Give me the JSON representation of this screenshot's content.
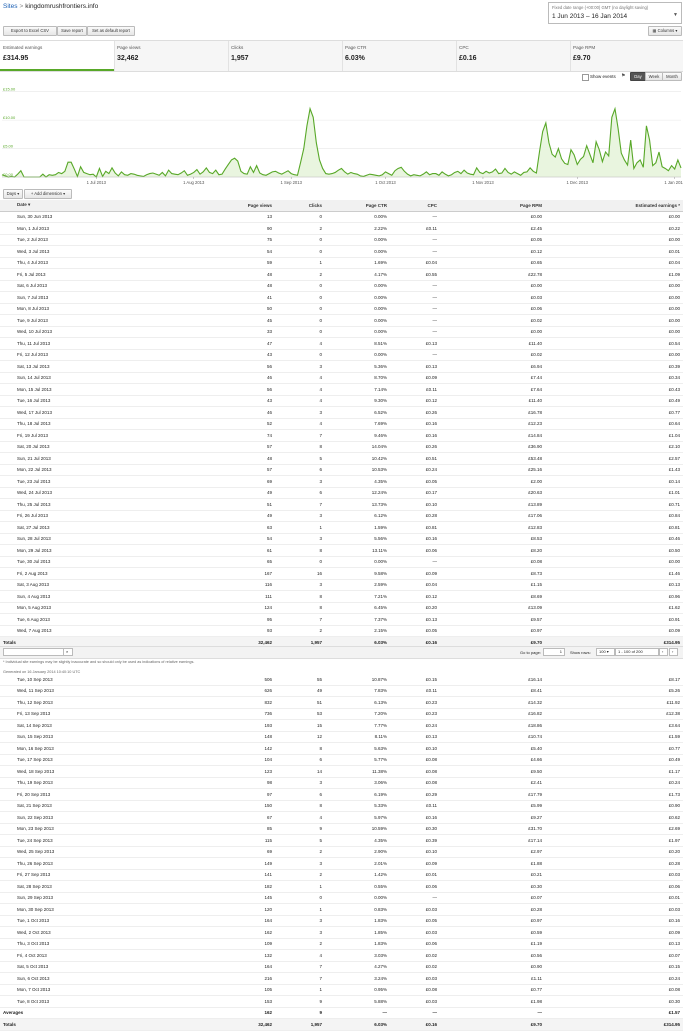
{
  "header": {
    "crumb_root": "Sites",
    "crumb_sep": ">",
    "site_name": "kingdomrushfrontiers.info",
    "date_note": "Fixed date range (+00:00) GMT (no daylight saving)",
    "date_range": "1 Jun 2013 – 16 Jan 2014"
  },
  "toolbar": {
    "export_label": "Export to Excel CSV",
    "save_label": "Save report",
    "default_label": "Set as default report",
    "columns_label": "Columns"
  },
  "scorecards": [
    {
      "label": "Estimated earnings",
      "value": "£314.95"
    },
    {
      "label": "Page views",
      "value": "32,462"
    },
    {
      "label": "Clicks",
      "value": "1,957"
    },
    {
      "label": "Page CTR",
      "value": "6.03%"
    },
    {
      "label": "CPC",
      "value": "£0.16"
    },
    {
      "label": "Page RPM",
      "value": "£9.70"
    }
  ],
  "chart_opts": {
    "show_events": "Show events",
    "day": "Day",
    "week": "Week",
    "month": "Month"
  },
  "chart_data": {
    "type": "area",
    "series": [
      {
        "values": [
          0.4,
          0.2,
          0.0,
          0.1,
          0.0,
          0.5,
          1.1,
          0.0,
          0.0,
          0.0,
          0.0,
          0.0,
          0.0,
          0.5,
          0.0,
          0.4,
          0.3,
          0.4,
          0.8,
          0.6,
          1.0,
          2.6,
          2.6,
          1.4,
          0.1,
          1.8,
          0.8,
          0.6,
          0.4,
          0.5,
          0.0,
          1.5,
          0.1,
          1.0,
          0.6,
          1.6,
          0.7,
          0.2,
          0.9,
          0.4,
          0.3,
          0.6,
          0.5,
          0.3,
          0.2,
          0.1,
          0.4,
          0.6,
          0.7,
          0.5,
          0.3,
          0.8,
          0.2,
          1.2,
          0.6,
          0.5,
          0.4,
          0.7,
          1.1,
          0.3,
          0.5,
          0.8,
          1.3,
          0.5,
          0.9,
          1.6,
          0.8,
          0.6,
          1.2,
          0.4,
          0.5,
          1.4,
          2.2,
          3.0,
          3.3,
          2.8,
          1.0,
          0.6,
          0.5,
          1.8,
          0.8,
          2.0,
          0.7,
          0.4,
          0.3,
          0.6,
          0.9,
          1.0,
          0.7,
          0.5,
          0.8,
          1.1,
          0.6,
          0.4,
          0.3,
          2.6,
          5.0,
          9.0,
          12.0,
          10.5,
          6.0,
          3.0,
          1.5,
          0.6,
          0.5,
          0.6,
          0.8,
          1.2,
          1.5,
          0.9,
          0.5,
          0.8,
          0.6,
          0.5,
          0.2,
          0.1,
          0.3,
          0.5,
          0.4,
          0.3,
          0.2,
          0.4,
          0.9,
          0.6,
          0.3,
          1.1,
          1.5,
          1.7,
          1.0,
          0.5,
          0.2,
          0.4,
          0.3,
          0.2,
          0.5,
          0.9,
          0.4,
          0.6,
          0.6,
          0.3,
          0.9,
          0.5,
          0.2,
          0.4,
          0.8,
          1.0,
          0.6,
          1.2,
          0.7,
          0.5,
          0.4,
          1.6,
          0.8,
          0.6,
          1.0,
          0.7,
          0.9,
          1.4,
          0.6,
          0.7,
          1.5,
          0.8,
          0.5,
          0.9,
          0.6,
          0.3,
          0.8,
          0.9,
          1.6,
          1.0,
          0.7,
          4.5,
          8.0,
          9.5,
          6.0,
          4.0,
          3.5,
          5.0,
          3.2,
          2.4,
          2.2,
          4.8,
          3.9,
          2.2,
          3.1,
          3.6,
          5.5,
          4.0,
          2.5,
          6.2,
          4.8,
          2.7,
          4.4,
          3.7,
          10.5,
          12.0,
          8.5,
          4.2,
          3.0,
          2.1,
          6.5,
          1.5,
          2.5,
          3.0,
          1.7,
          9.0,
          6.5,
          2.0,
          2.5,
          4.4,
          1.8,
          1.5,
          1.1,
          2.0,
          1.4,
          3.0,
          1.6
        ]
      }
    ],
    "ylabels": [
      "£15.00",
      "£10.00",
      "£5.00",
      "£0.00"
    ],
    "yticks": [
      15,
      10,
      5,
      0
    ],
    "ylim": [
      0,
      16
    ],
    "xlabels": [
      "1 Jul 2013",
      "1 Aug 2013",
      "1 Sep 2013",
      "1 Oct 2013",
      "1 Nov 2013",
      "1 Dec 2013",
      "1 Jan 2014"
    ],
    "xtick_days": [
      30,
      61,
      92,
      122,
      153,
      183,
      214
    ],
    "color": "#58a828",
    "fill": "#e9f5df"
  },
  "table_bar": {
    "dimension": "Days",
    "add_dimension": "Add dimension"
  },
  "columns": [
    "Date",
    "Page views",
    "Clicks",
    "Page CTR",
    "CPC",
    "Page RPM",
    "Estimated earnings"
  ],
  "top_rows": [
    [
      "Sun, 30 Jun 2013",
      "13",
      "0",
      "0.00%",
      "—",
      "£0.00",
      "£0.00"
    ],
    [
      "Mon, 1 Jul 2013",
      "90",
      "2",
      "2.22%",
      "£0.11",
      "£2.45",
      "£0.22"
    ],
    [
      "Tue, 2 Jul 2013",
      "75",
      "0",
      "0.00%",
      "—",
      "£0.05",
      "£0.00"
    ],
    [
      "Wed, 3 Jul 2013",
      "54",
      "0",
      "0.00%",
      "—",
      "£0.12",
      "£0.01"
    ],
    [
      "Thu, 4 Jul 2013",
      "59",
      "1",
      "1.69%",
      "£0.04",
      "£0.65",
      "£0.04"
    ],
    [
      "Fri, 5 Jul 2013",
      "48",
      "2",
      "4.17%",
      "£0.55",
      "£22.78",
      "£1.09"
    ],
    [
      "Sat, 6 Jul 2013",
      "48",
      "0",
      "0.00%",
      "—",
      "£0.00",
      "£0.00"
    ],
    [
      "Sun, 7 Jul 2013",
      "41",
      "0",
      "0.00%",
      "—",
      "£0.03",
      "£0.00"
    ],
    [
      "Mon, 8 Jul 2013",
      "50",
      "0",
      "0.00%",
      "—",
      "£0.06",
      "£0.00"
    ],
    [
      "Tue, 9 Jul 2013",
      "45",
      "0",
      "0.00%",
      "—",
      "£0.02",
      "£0.00"
    ],
    [
      "Wed, 10 Jul 2013",
      "33",
      "0",
      "0.00%",
      "—",
      "£0.00",
      "£0.00"
    ],
    [
      "Thu, 11 Jul 2013",
      "47",
      "4",
      "8.51%",
      "£0.13",
      "£11.40",
      "£0.54"
    ],
    [
      "Fri, 12 Jul 2013",
      "43",
      "0",
      "0.00%",
      "—",
      "£0.02",
      "£0.00"
    ],
    [
      "Sat, 13 Jul 2013",
      "56",
      "3",
      "5.36%",
      "£0.13",
      "£6.94",
      "£0.39"
    ],
    [
      "Sun, 14 Jul 2013",
      "46",
      "4",
      "8.70%",
      "£0.09",
      "£7.44",
      "£0.34"
    ],
    [
      "Mon, 15 Jul 2013",
      "56",
      "4",
      "7.14%",
      "£0.11",
      "£7.64",
      "£0.43"
    ],
    [
      "Tue, 16 Jul 2013",
      "43",
      "4",
      "9.30%",
      "£0.12",
      "£11.40",
      "£0.49"
    ],
    [
      "Wed, 17 Jul 2013",
      "46",
      "3",
      "6.52%",
      "£0.26",
      "£16.78",
      "£0.77"
    ],
    [
      "Thu, 18 Jul 2013",
      "52",
      "4",
      "7.69%",
      "£0.16",
      "£12.23",
      "£0.64"
    ],
    [
      "Fri, 19 Jul 2013",
      "74",
      "7",
      "9.46%",
      "£0.16",
      "£14.84",
      "£1.04"
    ],
    [
      "Sat, 20 Jul 2013",
      "57",
      "8",
      "14.04%",
      "£0.26",
      "£36.90",
      "£2.10"
    ],
    [
      "Sun, 21 Jul 2013",
      "48",
      "5",
      "10.42%",
      "£0.51",
      "£53.48",
      "£2.57"
    ],
    [
      "Mon, 22 Jul 2013",
      "57",
      "6",
      "10.53%",
      "£0.24",
      "£25.16",
      "£1.43"
    ],
    [
      "Tue, 23 Jul 2013",
      "69",
      "3",
      "4.35%",
      "£0.05",
      "£2.00",
      "£0.14"
    ],
    [
      "Wed, 24 Jul 2013",
      "49",
      "6",
      "12.24%",
      "£0.17",
      "£20.63",
      "£1.01"
    ],
    [
      "Thu, 25 Jul 2013",
      "51",
      "7",
      "13.73%",
      "£0.10",
      "£13.89",
      "£0.71"
    ],
    [
      "Fri, 26 Jul 2013",
      "49",
      "3",
      "6.12%",
      "£0.28",
      "£17.06",
      "£0.84"
    ],
    [
      "Sat, 27 Jul 2013",
      "63",
      "1",
      "1.59%",
      "£0.81",
      "£12.83",
      "£0.81"
    ],
    [
      "Sun, 28 Jul 2013",
      "54",
      "3",
      "5.56%",
      "£0.16",
      "£8.53",
      "£0.46"
    ],
    [
      "Mon, 29 Jul 2013",
      "61",
      "8",
      "13.11%",
      "£0.06",
      "£8.20",
      "£0.50"
    ],
    [
      "Tue, 30 Jul 2013",
      "65",
      "0",
      "0.00%",
      "—",
      "£0.08",
      "£0.00"
    ],
    [
      "Fri, 2 Aug 2013",
      "167",
      "16",
      "9.58%",
      "£0.09",
      "£8.73",
      "£1.46"
    ],
    [
      "Sat, 3 Aug 2013",
      "116",
      "3",
      "2.59%",
      "£0.04",
      "£1.15",
      "£0.13"
    ],
    [
      "Sun, 4 Aug 2013",
      "111",
      "8",
      "7.21%",
      "£0.12",
      "£8.69",
      "£0.96"
    ],
    [
      "Mon, 5 Aug 2013",
      "124",
      "8",
      "6.45%",
      "£0.20",
      "£13.09",
      "£1.62"
    ],
    [
      "Tue, 6 Aug 2013",
      "95",
      "7",
      "7.37%",
      "£0.13",
      "£9.57",
      "£0.91"
    ],
    [
      "Wed, 7 Aug 2013",
      "93",
      "2",
      "2.15%",
      "£0.05",
      "£0.97",
      "£0.09"
    ]
  ],
  "totals": {
    "label": "Totals",
    "page_views": "32,462",
    "clicks": "1,957",
    "ctr": "6.03%",
    "cpc": "£0.16",
    "rpm": "£9.70",
    "earnings": "£314.95"
  },
  "pager": {
    "go_to_page": "Go to page:",
    "page_value": "1",
    "show_rows": "Show rows:",
    "rows_value": "100",
    "range": "1 - 100 of 200"
  },
  "footnote": "* Individual site earnings may be slightly inaccurate and so should only be used as indications of relative earnings.",
  "generated": "Generated on 16 January 2014 10:40:10 UTC",
  "bottom_rows": [
    [
      "Tue, 10 Sep 2013",
      "506",
      "55",
      "10.87%",
      "£0.15",
      "£16.14",
      "£8.17"
    ],
    [
      "Wed, 11 Sep 2013",
      "626",
      "49",
      "7.83%",
      "£0.11",
      "£8.41",
      "£5.26"
    ],
    [
      "Thu, 12 Sep 2013",
      "832",
      "51",
      "6.13%",
      "£0.23",
      "£14.32",
      "£11.92"
    ],
    [
      "Fri, 13 Sep 2013",
      "736",
      "53",
      "7.20%",
      "£0.23",
      "£16.82",
      "£12.38"
    ],
    [
      "Sat, 14 Sep 2013",
      "193",
      "15",
      "7.77%",
      "£0.24",
      "£18.86",
      "£3.64"
    ],
    [
      "Sun, 15 Sep 2013",
      "148",
      "12",
      "8.11%",
      "£0.13",
      "£10.74",
      "£1.59"
    ],
    [
      "Mon, 16 Sep 2013",
      "142",
      "8",
      "5.63%",
      "£0.10",
      "£5.40",
      "£0.77"
    ],
    [
      "Tue, 17 Sep 2013",
      "104",
      "6",
      "5.77%",
      "£0.08",
      "£4.66",
      "£0.49"
    ],
    [
      "Wed, 18 Sep 2013",
      "123",
      "14",
      "11.38%",
      "£0.08",
      "£9.50",
      "£1.17"
    ],
    [
      "Thu, 19 Sep 2013",
      "98",
      "3",
      "3.06%",
      "£0.08",
      "£2.41",
      "£0.24"
    ],
    [
      "Fri, 20 Sep 2013",
      "97",
      "6",
      "6.19%",
      "£0.29",
      "£17.79",
      "£1.73"
    ],
    [
      "Sat, 21 Sep 2013",
      "150",
      "8",
      "5.33%",
      "£0.11",
      "£5.99",
      "£0.90"
    ],
    [
      "Sun, 22 Sep 2013",
      "67",
      "4",
      "5.97%",
      "£0.16",
      "£9.27",
      "£0.62"
    ],
    [
      "Mon, 23 Sep 2013",
      "85",
      "9",
      "10.59%",
      "£0.30",
      "£31.70",
      "£2.69"
    ],
    [
      "Tue, 24 Sep 2013",
      "115",
      "5",
      "4.35%",
      "£0.39",
      "£17.14",
      "£1.97"
    ],
    [
      "Wed, 25 Sep 2013",
      "69",
      "2",
      "2.90%",
      "£0.10",
      "£2.97",
      "£0.20"
    ],
    [
      "Thu, 26 Sep 2013",
      "149",
      "3",
      "2.01%",
      "£0.09",
      "£1.88",
      "£0.28"
    ],
    [
      "Fri, 27 Sep 2013",
      "141",
      "2",
      "1.42%",
      "£0.01",
      "£0.21",
      "£0.03"
    ],
    [
      "Sat, 28 Sep 2013",
      "182",
      "1",
      "0.55%",
      "£0.06",
      "£0.30",
      "£0.06"
    ],
    [
      "Sun, 29 Sep 2013",
      "145",
      "0",
      "0.00%",
      "—",
      "£0.07",
      "£0.01"
    ],
    [
      "Mon, 30 Sep 2013",
      "120",
      "1",
      "0.83%",
      "£0.03",
      "£0.28",
      "£0.03"
    ],
    [
      "Tue, 1 Oct 2013",
      "164",
      "3",
      "1.83%",
      "£0.05",
      "£0.97",
      "£0.16"
    ],
    [
      "Wed, 2 Oct 2013",
      "162",
      "3",
      "1.85%",
      "£0.03",
      "£0.59",
      "£0.09"
    ],
    [
      "Thu, 3 Oct 2013",
      "109",
      "2",
      "1.83%",
      "£0.06",
      "£1.19",
      "£0.13"
    ],
    [
      "Fri, 4 Oct 2013",
      "132",
      "4",
      "3.03%",
      "£0.02",
      "£0.56",
      "£0.07"
    ],
    [
      "Sat, 5 Oct 2013",
      "164",
      "7",
      "4.27%",
      "£0.02",
      "£0.90",
      "£0.15"
    ],
    [
      "Sun, 6 Oct 2013",
      "216",
      "7",
      "3.24%",
      "£0.03",
      "£1.11",
      "£0.24"
    ],
    [
      "Mon, 7 Oct 2013",
      "105",
      "1",
      "0.95%",
      "£0.08",
      "£0.77",
      "£0.08"
    ],
    [
      "Tue, 8 Oct 2013",
      "153",
      "9",
      "5.88%",
      "£0.03",
      "£1.98",
      "£0.30"
    ]
  ],
  "averages": {
    "label": "Averages",
    "page_views": "162",
    "clicks": "9",
    "ctr": "—",
    "cpc": "—",
    "rpm": "—",
    "earnings": "£1.57"
  }
}
